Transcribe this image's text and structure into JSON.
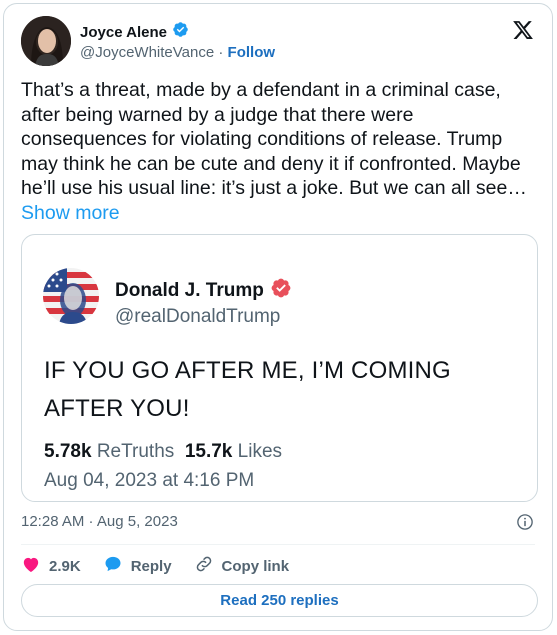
{
  "tweet": {
    "author_name": "Joyce Alene",
    "author_handle": "@JoyceWhiteVance",
    "separator": "·",
    "follow_label": "Follow",
    "text": "That’s a threat, made by a defendant in a criminal case, after being warned by a judge that there were consequences for violating conditions of release. Trump may think he can be cute and deny it if confronted. Maybe he’ll use his usual line: it’s just a joke. But we can all see…",
    "show_more_label": "Show more",
    "timestamp": "12:28 AM · Aug 5, 2023"
  },
  "quote": {
    "author_name": "Donald J. Trump",
    "author_handle": "@realDonaldTrump",
    "text": "IF YOU GO AFTER ME, I’M COMING AFTER YOU!",
    "retruths_count": "5.78k",
    "retruths_label": "ReTruths",
    "likes_count": "15.7k",
    "likes_label": "Likes",
    "date": "Aug 04, 2023 at 4:16 PM"
  },
  "actions": {
    "likes_count": "2.9K",
    "reply_label": "Reply",
    "copy_link_label": "Copy link"
  },
  "read_replies_label": "Read 250 replies",
  "colors": {
    "verified_blue": "#1d9bf0",
    "truth_badge_red": "#e8505b",
    "heart_red": "#f91880",
    "link_blue": "#1d6fbf"
  },
  "icons": [
    "verified-badge-icon",
    "x-logo-icon",
    "truth-verified-badge-icon",
    "info-icon",
    "heart-icon",
    "reply-bubble-icon",
    "link-icon"
  ]
}
